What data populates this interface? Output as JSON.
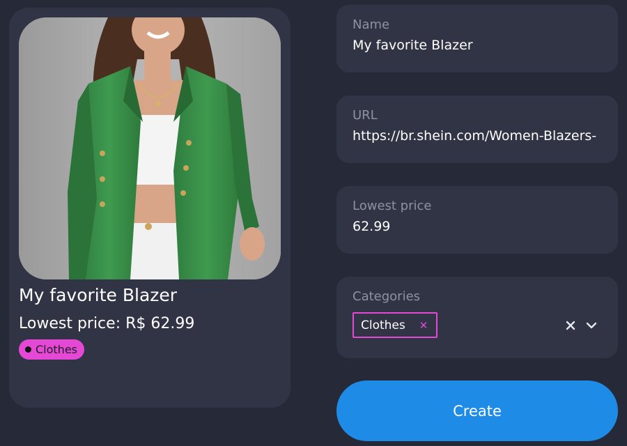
{
  "preview": {
    "image_alt": "Woman wearing green double-breasted blazer",
    "name": "My favorite Blazer",
    "price_text": "Lowest price: R$ 62.99",
    "category": "Clothes",
    "category_color": "#e648d6"
  },
  "form": {
    "name": {
      "label": "Name",
      "value": "My favorite Blazer"
    },
    "url": {
      "label": "URL",
      "value": "https://br.shein.com/Women-Blazers-"
    },
    "lowest_price": {
      "label": "Lowest price",
      "value": "62.99"
    },
    "categories": {
      "label": "Categories",
      "selected": [
        "Clothes"
      ],
      "remove_icon": "x-icon",
      "clear_icon": "clear-icon",
      "dropdown_icon": "chevron-down-icon"
    },
    "submit_label": "Create"
  },
  "colors": {
    "background": "#262a38",
    "card": "#303445",
    "accent": "#1e8ce6",
    "tag": "#e648d6"
  }
}
